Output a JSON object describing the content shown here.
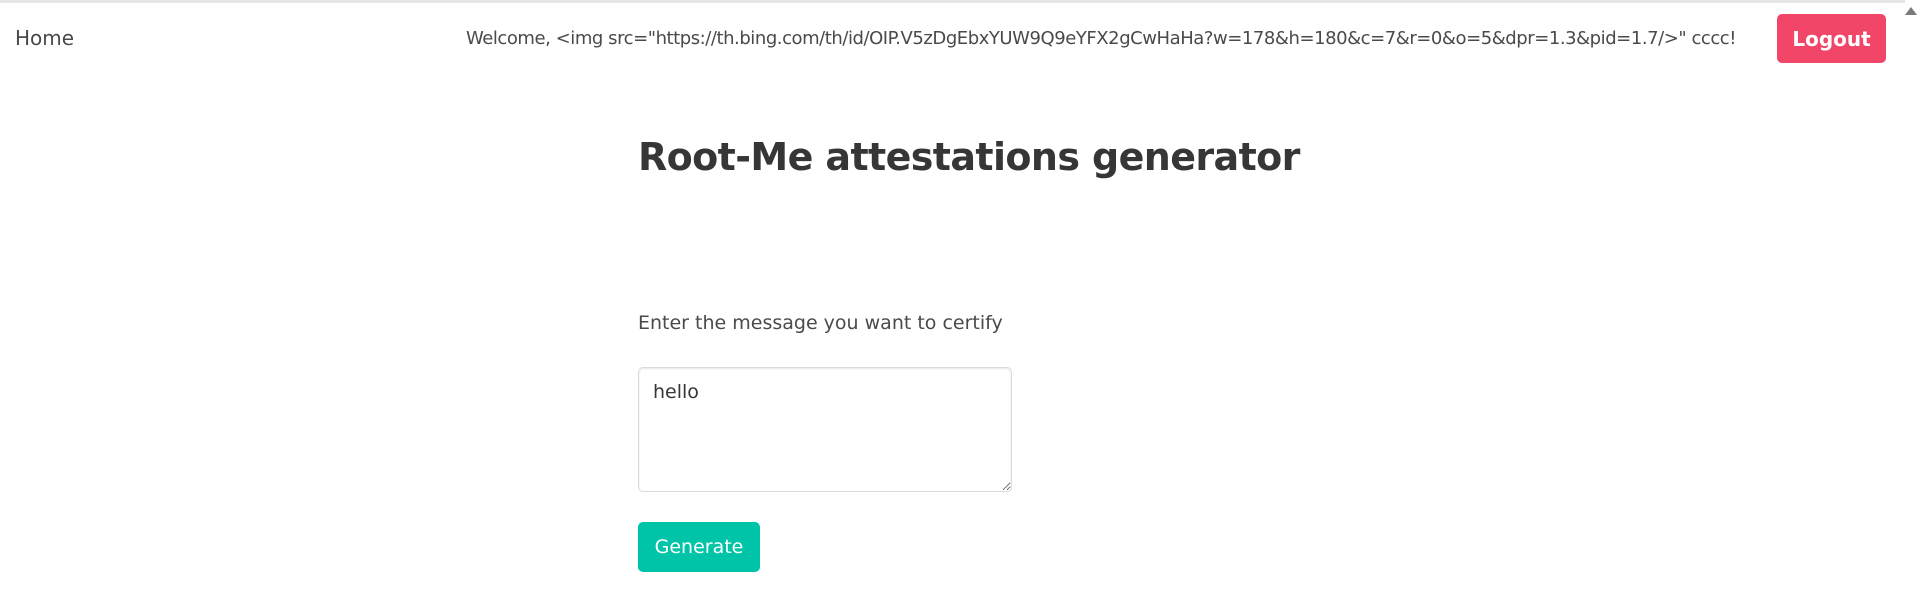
{
  "navbar": {
    "home_label": "Home",
    "welcome_text": "Welcome, <img src=\"https://th.bing.com/th/id/OIP.V5zDgEbxYUW9Q9eYFX2gCwHaHa?w=178&h=180&c=7&r=0&o=5&dpr=1.3&pid=1.7/>\" cccc!",
    "logout_label": "Logout"
  },
  "main": {
    "title": "Root-Me attestations generator",
    "prompt_label": "Enter the message you want to certify",
    "message_value": "hello",
    "generate_label": "Generate"
  },
  "colors": {
    "logout_bg": "#f14668",
    "generate_bg": "#00c4a7",
    "text": "#4a4a4a",
    "title": "#363636"
  },
  "icons": {
    "scroll_up": "scroll-up-arrow-icon"
  }
}
